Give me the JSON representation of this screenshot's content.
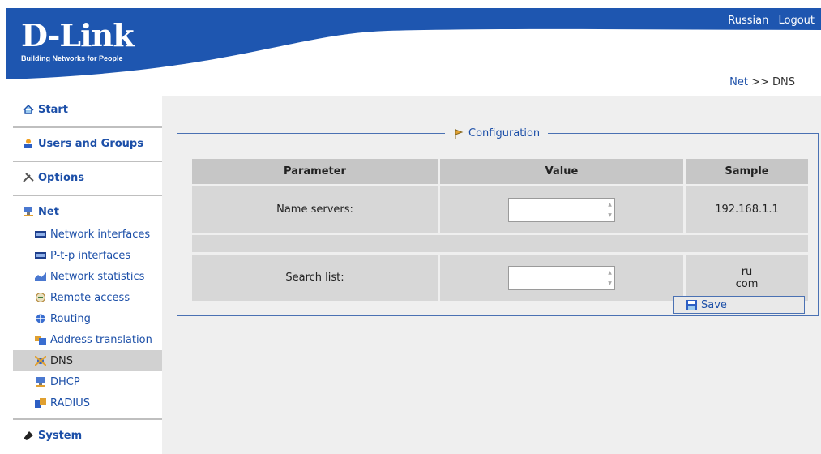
{
  "header": {
    "logo": "D-Link",
    "tagline": "Building Networks for People",
    "links": [
      "Russian",
      "Logout"
    ],
    "brand_color": "#1e56b0"
  },
  "breadcrumb": {
    "parent": "Net",
    "sep": ">>",
    "current": "DNS"
  },
  "sidebar": {
    "sections": {
      "start": "Start",
      "users": "Users and Groups",
      "options": "Options",
      "net": "Net",
      "system": "System"
    },
    "net_items": [
      "Network interfaces",
      "P-t-p interfaces",
      "Network statistics",
      "Remote access",
      "Routing",
      "Address translation",
      "DNS",
      "DHCP",
      "RADIUS"
    ]
  },
  "config": {
    "legend": "Configuration",
    "headers": [
      "Parameter",
      "Value",
      "Sample"
    ],
    "name_servers": {
      "label": "Name servers:",
      "value": "",
      "sample": "192.168.1.1"
    },
    "search_list": {
      "label": "Search list:",
      "value": "",
      "sample1": "ru",
      "sample2": "com"
    },
    "save": "Save"
  }
}
